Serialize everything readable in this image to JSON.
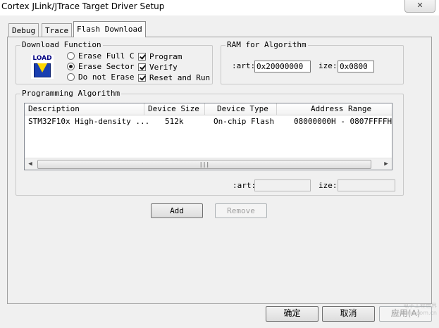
{
  "window": {
    "title": "Cortex JLink/JTrace Target Driver Setup"
  },
  "tabs": [
    {
      "label": "Debug"
    },
    {
      "label": "Trace"
    },
    {
      "label": "Flash Download"
    }
  ],
  "download_function": {
    "group_label": "Download Function",
    "icon_text": "LOAD",
    "erase_options": [
      {
        "label": "Erase Full C",
        "selected": false
      },
      {
        "label": "Erase Sector",
        "selected": true
      },
      {
        "label": "Do not Erase",
        "selected": false
      }
    ],
    "checks": [
      {
        "label": "Program",
        "checked": true
      },
      {
        "label": "Verify",
        "checked": true
      },
      {
        "label": "Reset and Run",
        "checked": true
      }
    ]
  },
  "ram": {
    "group_label": "RAM for Algorithm",
    "start_label": ":art:",
    "start_value": "0x20000000",
    "size_label": "ize:",
    "size_value": "0x0800"
  },
  "programming": {
    "group_label": "Programming Algorithm",
    "columns": [
      "Description",
      "Device Size",
      "Device Type",
      "Address Range"
    ],
    "rows": [
      [
        "STM32F10x High-density ...",
        "512k",
        "On-chip Flash",
        "08000000H - 0807FFFFH"
      ]
    ],
    "start_label": ":art:",
    "start_value": "",
    "size_label": "ize:",
    "size_value": ""
  },
  "buttons": {
    "add": "Add",
    "remove": "Remove",
    "ok": "确定",
    "cancel": "取消",
    "apply": "应用(A)"
  },
  "watermark": "电子工程世界 eeworld.com.cn"
}
